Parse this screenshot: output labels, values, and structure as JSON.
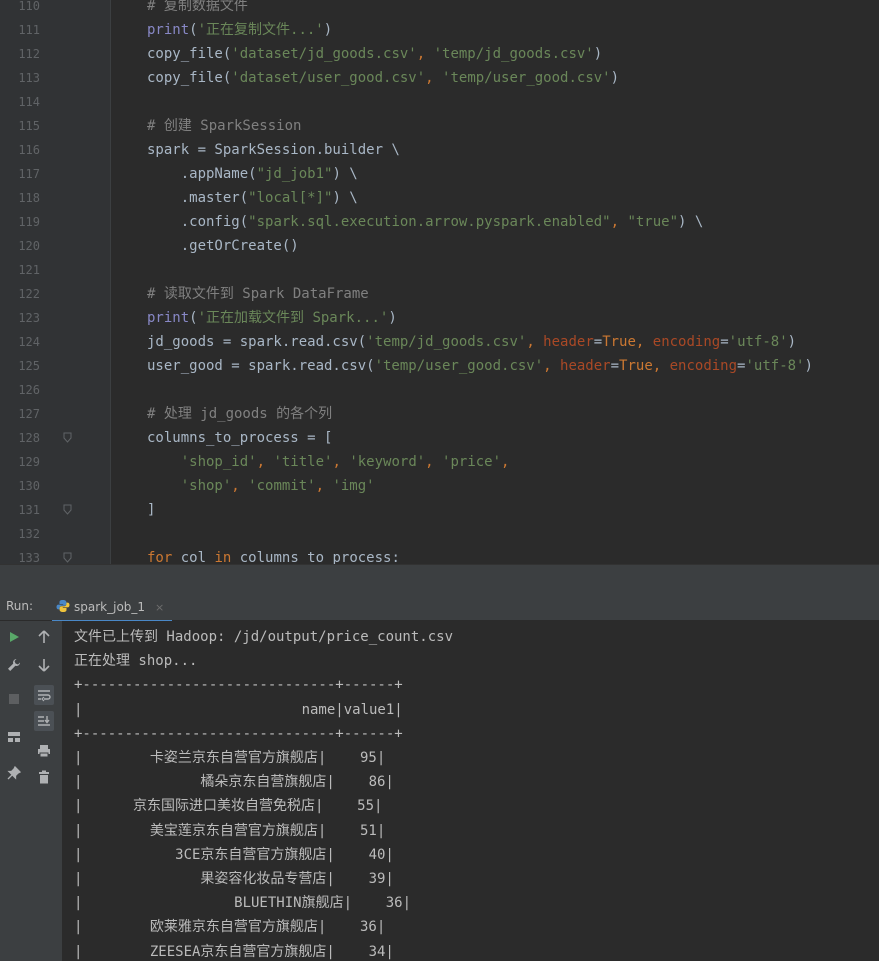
{
  "editor": {
    "line_numbers": [
      "110",
      "111",
      "112",
      "113",
      "114",
      "115",
      "116",
      "117",
      "118",
      "119",
      "120",
      "121",
      "122",
      "123",
      "124",
      "125",
      "126",
      "127",
      "128",
      "129",
      "130",
      "131",
      "132",
      "133"
    ],
    "lines": [
      [
        {
          "t": "# 复制数据文件",
          "c": "cmt"
        }
      ],
      [
        {
          "t": "print",
          "c": "bi"
        },
        {
          "t": "(",
          "c": "fn"
        },
        {
          "t": "'正在复制文件...'",
          "c": "str"
        },
        {
          "t": ")",
          "c": "fn"
        }
      ],
      [
        {
          "t": "copy_file(",
          "c": "fn"
        },
        {
          "t": "'dataset/jd_goods.csv'",
          "c": "str"
        },
        {
          "t": ", ",
          "c": "kw"
        },
        {
          "t": "'temp/jd_goods.csv'",
          "c": "str"
        },
        {
          "t": ")",
          "c": "fn"
        }
      ],
      [
        {
          "t": "copy_file(",
          "c": "fn"
        },
        {
          "t": "'dataset/user_good.csv'",
          "c": "str"
        },
        {
          "t": ", ",
          "c": "kw"
        },
        {
          "t": "'temp/user_good.csv'",
          "c": "str"
        },
        {
          "t": ")",
          "c": "fn"
        }
      ],
      [],
      [
        {
          "t": "# 创建 SparkSession",
          "c": "cmt"
        }
      ],
      [
        {
          "t": "spark = SparkSession.builder \\",
          "c": "fn"
        }
      ],
      [
        {
          "t": "    .appName(",
          "c": "fn"
        },
        {
          "t": "\"jd_job1\"",
          "c": "str"
        },
        {
          "t": ") \\",
          "c": "fn"
        }
      ],
      [
        {
          "t": "    .master(",
          "c": "fn"
        },
        {
          "t": "\"local[*]\"",
          "c": "str"
        },
        {
          "t": ") \\",
          "c": "fn"
        }
      ],
      [
        {
          "t": "    .config(",
          "c": "fn"
        },
        {
          "t": "\"spark.sql.execution.arrow.pyspark.enabled\"",
          "c": "str"
        },
        {
          "t": ", ",
          "c": "kw"
        },
        {
          "t": "\"true\"",
          "c": "str"
        },
        {
          "t": ") \\",
          "c": "fn"
        }
      ],
      [
        {
          "t": "    .getOrCreate()",
          "c": "fn"
        }
      ],
      [],
      [
        {
          "t": "# 读取文件到 Spark DataFrame",
          "c": "cmt"
        }
      ],
      [
        {
          "t": "print",
          "c": "bi"
        },
        {
          "t": "(",
          "c": "fn"
        },
        {
          "t": "'正在加载文件到 Spark...'",
          "c": "str"
        },
        {
          "t": ")",
          "c": "fn"
        }
      ],
      [
        {
          "t": "jd_goods = spark.read.csv(",
          "c": "fn"
        },
        {
          "t": "'temp/jd_goods.csv'",
          "c": "str"
        },
        {
          "t": ", ",
          "c": "kw"
        },
        {
          "t": "header",
          "c": "kwp"
        },
        {
          "t": "=",
          "c": "fn"
        },
        {
          "t": "True",
          "c": "kw"
        },
        {
          "t": ", ",
          "c": "kw"
        },
        {
          "t": "encoding",
          "c": "kwp"
        },
        {
          "t": "=",
          "c": "fn"
        },
        {
          "t": "'utf-8'",
          "c": "str"
        },
        {
          "t": ")",
          "c": "fn"
        }
      ],
      [
        {
          "t": "user_good = spark.read.csv(",
          "c": "fn"
        },
        {
          "t": "'temp/user_good.csv'",
          "c": "str"
        },
        {
          "t": ", ",
          "c": "kw"
        },
        {
          "t": "header",
          "c": "kwp"
        },
        {
          "t": "=",
          "c": "fn"
        },
        {
          "t": "True",
          "c": "kw"
        },
        {
          "t": ", ",
          "c": "kw"
        },
        {
          "t": "encoding",
          "c": "kwp"
        },
        {
          "t": "=",
          "c": "fn"
        },
        {
          "t": "'utf-8'",
          "c": "str"
        },
        {
          "t": ")",
          "c": "fn"
        }
      ],
      [],
      [
        {
          "t": "# 处理 jd_goods 的各个列",
          "c": "cmt"
        }
      ],
      [
        {
          "t": "columns_to_process = [",
          "c": "fn"
        }
      ],
      [
        {
          "t": "    ",
          "c": "fn"
        },
        {
          "t": "'shop_id'",
          "c": "str"
        },
        {
          "t": ", ",
          "c": "kw"
        },
        {
          "t": "'title'",
          "c": "str"
        },
        {
          "t": ", ",
          "c": "kw"
        },
        {
          "t": "'keyword'",
          "c": "str"
        },
        {
          "t": ", ",
          "c": "kw"
        },
        {
          "t": "'price'",
          "c": "str"
        },
        {
          "t": ",",
          "c": "kw"
        }
      ],
      [
        {
          "t": "    ",
          "c": "fn"
        },
        {
          "t": "'shop'",
          "c": "str"
        },
        {
          "t": ", ",
          "c": "kw"
        },
        {
          "t": "'commit'",
          "c": "str"
        },
        {
          "t": ", ",
          "c": "kw"
        },
        {
          "t": "'img'",
          "c": "str"
        }
      ],
      [
        {
          "t": "]",
          "c": "fn"
        }
      ],
      [],
      [
        {
          "t": "for",
          "c": "kw"
        },
        {
          "t": " col ",
          "c": "fn"
        },
        {
          "t": "in",
          "c": "kw"
        },
        {
          "t": " columns_to_process:",
          "c": "fn"
        }
      ]
    ]
  },
  "run_panel": {
    "label": "Run:",
    "tab_label": "spark_job_1",
    "tab_close": "×"
  },
  "console": {
    "lines": [
      "文件已上传到 Hadoop: /jd/output/price_count.csv",
      "正在处理 shop...",
      "+------------------------------+------+",
      "|                          name|value1|",
      "+------------------------------+------+",
      "|        卡姿兰京东自营官方旗舰店|    95|",
      "|              橘朵京东自营旗舰店|    86|",
      "|      京东国际进口美妆自营免税店|    55|",
      "|        美宝莲京东自营官方旗舰店|    51|",
      "|           3CE京东自营官方旗舰店|    40|",
      "|              果姿容化妆品专营店|    39|",
      "|                  BLUETHIN旗舰店|    36|",
      "|        欧莱雅京东自营官方旗舰店|    36|",
      "|        ZEESEA京东自营官方旗舰店|    34|"
    ]
  }
}
